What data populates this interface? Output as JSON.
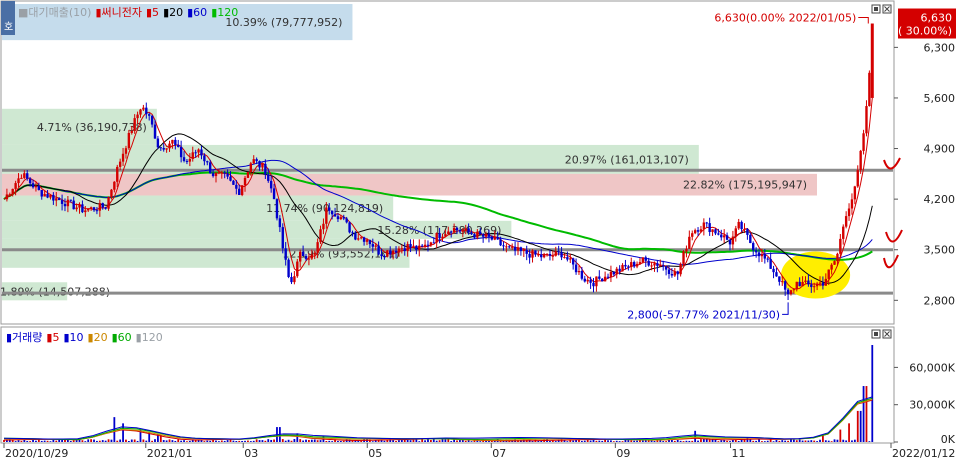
{
  "top_legend": {
    "series": [
      {
        "label": "■대기매출(10)",
        "color": "#9aa0a6"
      },
      {
        "label": "▮써니전자",
        "color": "#d40000"
      },
      {
        "label": "▮5",
        "color": "#d40000"
      },
      {
        "label": "▮20",
        "color": "#000000"
      },
      {
        "label": "▮60",
        "color": "#0000cc"
      },
      {
        "label": "▮120",
        "color": "#00bb00"
      }
    ],
    "corner_label": "호"
  },
  "bottom_legend": {
    "series": [
      {
        "label": "▮거래량",
        "color": "#0000cc"
      },
      {
        "label": "▮5",
        "color": "#d40000"
      },
      {
        "label": "▮10",
        "color": "#0000cc"
      },
      {
        "label": "▮20",
        "color": "#cc8800"
      },
      {
        "label": "▮60",
        "color": "#00aa00"
      },
      {
        "label": "▮120",
        "color": "#9aa0a6"
      }
    ]
  },
  "chart_data": [
    {
      "type": "candlestick",
      "ylim": [
        2500,
        6900
      ],
      "y_ticks": [
        "6,300",
        "5,600",
        "4,900",
        "4,200",
        "3,500",
        "2,800"
      ],
      "y_tick_values": [
        6300,
        5600,
        4900,
        4200,
        3500,
        2800
      ],
      "price_tag": {
        "value": 6630,
        "label": "6,630",
        "sub": "( 30.00%)",
        "color": "#d40000"
      },
      "max_annotation": {
        "value": 6630,
        "text": "6,630(0.00% 2022/01/05)",
        "color": "#d40000"
      },
      "min_annotation": {
        "value": 2800,
        "text": "2,800(-57.77% 2021/11/30)",
        "color": "#0000cc"
      },
      "volume_profile": [
        {
          "low": 6400,
          "high": 6900,
          "text": "10.39% (79,777,952)",
          "fill": "#c5dcec",
          "level": 0.43
        },
        {
          "low": 4950,
          "high": 5450,
          "text": "4.71% (36,190,738)",
          "fill": "#cfe8d2",
          "level": 0.19
        },
        {
          "low": 4550,
          "high": 4950,
          "text": "20.97% (161,013,107)",
          "fill": "#cfe8d2",
          "level": 0.855
        },
        {
          "low": 4250,
          "high": 4550,
          "text": "22.82% (175,195,947)",
          "fill": "#efc6c6",
          "level": 1.0
        },
        {
          "low": 3900,
          "high": 4250,
          "text": "11.74% (90,124,819)",
          "fill": "#cfe8d2",
          "level": 0.48
        },
        {
          "low": 3650,
          "high": 3900,
          "text": "15.28% (117,380,269)",
          "fill": "#cfe8d2",
          "level": 0.625
        },
        {
          "low": 3250,
          "high": 3650,
          "text": "12.19% (93,552,161)",
          "fill": "#cfe8d2",
          "level": 0.5
        },
        {
          "low": 2800,
          "high": 3050,
          "text": "1.89% (14,507,288)",
          "fill": "#cfe8d2",
          "level": 0.08
        }
      ],
      "horizontal_lines": [
        4600,
        3500,
        2900
      ],
      "highlight_ellipse": {
        "x0": 0.877,
        "x1": 0.955,
        "y_center": 3150,
        "y_span": 650,
        "color": "#ffee00"
      },
      "series_colors": {
        "up": "#d40000",
        "down": "#0000cc",
        "ma5": "#d40000",
        "ma20": "#000000",
        "ma60": "#0000cc",
        "ma120": "#00bb00"
      },
      "price_path": [
        [
          0.0,
          4200
        ],
        [
          0.02,
          4550
        ],
        [
          0.04,
          4300
        ],
        [
          0.07,
          4150
        ],
        [
          0.09,
          4050
        ],
        [
          0.115,
          4100
        ],
        [
          0.13,
          4700
        ],
        [
          0.145,
          5200
        ],
        [
          0.155,
          5500
        ],
        [
          0.165,
          5300
        ],
        [
          0.175,
          4900
        ],
        [
          0.19,
          5000
        ],
        [
          0.205,
          4700
        ],
        [
          0.22,
          4900
        ],
        [
          0.235,
          4550
        ],
        [
          0.25,
          4500
        ],
        [
          0.265,
          4300
        ],
        [
          0.28,
          4750
        ],
        [
          0.295,
          4600
        ],
        [
          0.305,
          4200
        ],
        [
          0.315,
          3500
        ],
        [
          0.323,
          3000
        ],
        [
          0.335,
          3450
        ],
        [
          0.35,
          3400
        ],
        [
          0.365,
          4100
        ],
        [
          0.38,
          3950
        ],
        [
          0.395,
          3700
        ],
        [
          0.41,
          3650
        ],
        [
          0.425,
          3450
        ],
        [
          0.44,
          3500
        ],
        [
          0.455,
          3550
        ],
        [
          0.47,
          3500
        ],
        [
          0.49,
          3700
        ],
        [
          0.505,
          3800
        ],
        [
          0.52,
          3750
        ],
        [
          0.535,
          3700
        ],
        [
          0.55,
          3650
        ],
        [
          0.57,
          3500
        ],
        [
          0.59,
          3450
        ],
        [
          0.61,
          3400
        ],
        [
          0.63,
          3450
        ],
        [
          0.655,
          3100
        ],
        [
          0.665,
          3050
        ],
        [
          0.68,
          3150
        ],
        [
          0.7,
          3250
        ],
        [
          0.72,
          3350
        ],
        [
          0.74,
          3300
        ],
        [
          0.76,
          3150
        ],
        [
          0.775,
          3750
        ],
        [
          0.79,
          3850
        ],
        [
          0.81,
          3700
        ],
        [
          0.82,
          3600
        ],
        [
          0.83,
          3850
        ],
        [
          0.845,
          3550
        ],
        [
          0.86,
          3350
        ],
        [
          0.875,
          3100
        ],
        [
          0.885,
          2850
        ],
        [
          0.895,
          3050
        ],
        [
          0.91,
          3000
        ],
        [
          0.925,
          3050
        ],
        [
          0.94,
          3400
        ],
        [
          0.95,
          4000
        ],
        [
          0.96,
          4300
        ],
        [
          0.968,
          4900
        ],
        [
          0.975,
          5600
        ],
        [
          0.98,
          6630
        ]
      ]
    },
    {
      "type": "bar",
      "title": "거래량",
      "ylim": [
        0,
        78000
      ],
      "y_ticks": [
        "60,000K",
        "30,000K",
        "0K"
      ],
      "y_tick_values": [
        60000,
        30000,
        0
      ],
      "x_tick_labels": [
        "2020/10/29",
        "2021/01",
        "03",
        "05",
        "07",
        "09",
        "11",
        "2022/01/12"
      ],
      "x_tick_positions": [
        0.0,
        0.16,
        0.27,
        0.41,
        0.55,
        0.69,
        0.82,
        1.0
      ],
      "spikes": [
        [
          0.125,
          20000
        ],
        [
          0.135,
          15000
        ],
        [
          0.155,
          10000
        ],
        [
          0.165,
          8000
        ],
        [
          0.175,
          6000
        ],
        [
          0.31,
          12000
        ],
        [
          0.33,
          7000
        ],
        [
          0.36,
          5000
        ],
        [
          0.495,
          3000
        ],
        [
          0.78,
          9000
        ],
        [
          0.84,
          3500
        ],
        [
          0.925,
          5000
        ],
        [
          0.945,
          10000
        ],
        [
          0.955,
          15000
        ],
        [
          0.965,
          25000
        ],
        [
          0.972,
          45000
        ],
        [
          0.98,
          78000
        ]
      ]
    }
  ]
}
